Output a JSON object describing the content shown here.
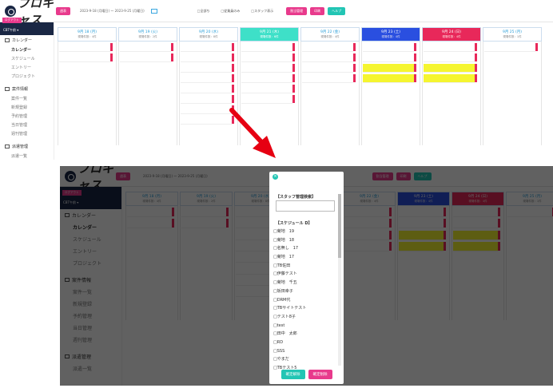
{
  "header": {
    "logo": "プロキャス",
    "btn_left": "週表",
    "date_range": "2023-9-18 (月曜日) ～ 2023-9-25 (月曜日)",
    "check1": "□全部ち",
    "check2": "□従業員のみ",
    "check3": "□スタッフ表示",
    "btn_r1": "割当管理",
    "btn_r2": "印刷",
    "btn_r3": "ヘルプ"
  },
  "sidebar": {
    "tag": "ログアウト",
    "user": "CBT午前 ▾",
    "sec1": "カレンダー",
    "items1": [
      "カレンダー",
      "スケジュール",
      "エントリー",
      "プロジェクト"
    ],
    "sec2": "案件情報",
    "items2": [
      "案件一覧",
      "新規登録",
      "予約管理",
      "当日管理",
      "週刊管理"
    ],
    "sec3": "派遣管理",
    "items3": [
      "派遣一覧"
    ]
  },
  "calendar": {
    "columns": [
      {
        "day": "9月 18 (月)",
        "sub": "現場件数：4件",
        "kind": ""
      },
      {
        "day": "9月 19 (火)",
        "sub": "現場件数：2件",
        "kind": ""
      },
      {
        "day": "9月 20 (水)",
        "sub": "現場件数：8件",
        "kind": ""
      },
      {
        "day": "9月 21 (木)",
        "sub": "現場件数：6件",
        "kind": "today"
      },
      {
        "day": "9月 22 (金)",
        "sub": "現場件数：4件",
        "kind": ""
      },
      {
        "day": "9月 23 (土)",
        "sub": "現場件数：4件",
        "kind": "sat"
      },
      {
        "day": "9月 24 (日)",
        "sub": "現場件数：4件",
        "kind": "sun"
      },
      {
        "day": "9月 25 (月)",
        "sub": "現場件数：1件",
        "kind": ""
      }
    ]
  },
  "modal": {
    "title1": "【スタッフ管理検索】",
    "title2": "【スケジュール D】",
    "staff": [
      "□菊地　19",
      "□菊地　18",
      "□名無し　17",
      "□菊地　17",
      "□TB佐田",
      "□伊藤テスト",
      "□菊地　千五",
      "□坂田幸子",
      "□DRM代",
      "□TBサイトテスト",
      "□テスト8子",
      "□test",
      "□田中　太郎",
      "□RD",
      "□SSS",
      "□やまだ",
      "□TBテスト5"
    ],
    "confirm": "確定解除",
    "cancel": "確定削除"
  },
  "colors": {
    "navy": "#1a2744",
    "pink": "#e83a8c",
    "teal": "#22c5b4",
    "arrow": "#e60012"
  }
}
